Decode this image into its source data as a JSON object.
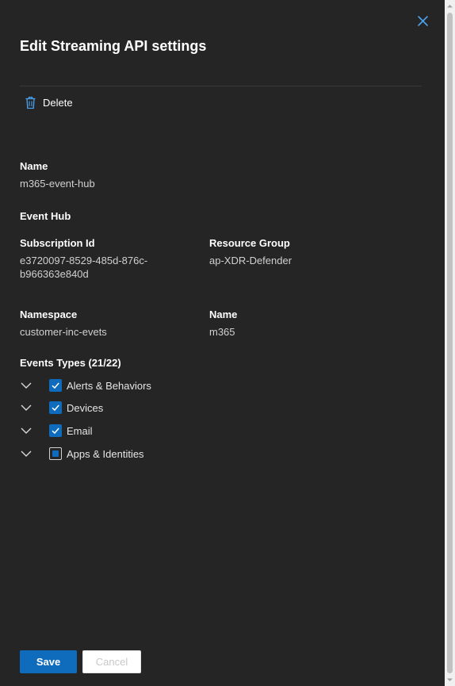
{
  "panel": {
    "title": "Edit Streaming API settings",
    "close_icon": "close-icon",
    "delete_label": "Delete",
    "delete_icon": "trash-icon"
  },
  "details": {
    "name_label": "Name",
    "name_value": "m365-event-hub",
    "event_hub_label": "Event Hub",
    "subscription_label": "Subscription Id",
    "subscription_line1": "e3720097-8529-485d-876c-",
    "subscription_line2": "b966363e840d",
    "resource_group_label": "Resource Group",
    "resource_group_value": "ap-XDR-Defender",
    "namespace_label": "Namespace",
    "namespace_value": "customer-inc-evets",
    "hub_name_label": "Name",
    "hub_name_value": "m365"
  },
  "events": {
    "heading": "Events Types (21/22)",
    "items": [
      {
        "label": "Alerts & Behaviors",
        "state": "checked"
      },
      {
        "label": "Devices",
        "state": "checked"
      },
      {
        "label": "Email",
        "state": "checked"
      },
      {
        "label": "Apps & Identities",
        "state": "partial"
      }
    ]
  },
  "footer": {
    "save_label": "Save",
    "cancel_label": "Cancel"
  },
  "colors": {
    "panel_bg": "#252526",
    "accent": "#0f6cbd"
  }
}
